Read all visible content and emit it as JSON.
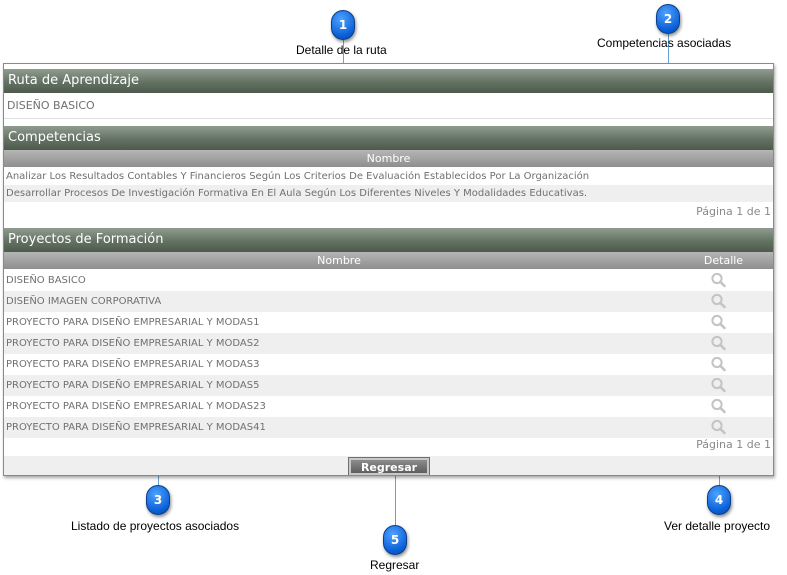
{
  "ruta": {
    "header": "Ruta de Aprendizaje",
    "value": "DISEÑO BASICO"
  },
  "competencias": {
    "header": "Competencias",
    "column": "Nombre",
    "rows": [
      "Analizar Los Resultados Contables Y Financieros Según Los Criterios De Evaluación Establecidos Por La Organización",
      "Desarrollar Procesos De Investigación Formativa En El Aula Según Los Diferentes Niveles Y Modalidades Educativas."
    ],
    "pager": "Página 1 de 1"
  },
  "proyectos": {
    "header": "Proyectos de Formación",
    "col_name": "Nombre",
    "col_detail": "Detalle",
    "rows": [
      "DISEÑO BASICO",
      "DISEÑO IMAGEN CORPORATIVA",
      "PROYECTO PARA DISEÑO EMPRESARIAL Y MODAS1",
      "PROYECTO PARA DISEÑO EMPRESARIAL Y MODAS2",
      "PROYECTO PARA DISEÑO EMPRESARIAL Y MODAS3",
      "PROYECTO PARA DISEÑO EMPRESARIAL Y MODAS5",
      "PROYECTO PARA DISEÑO EMPRESARIAL Y MODAS23",
      "PROYECTO PARA DISEÑO EMPRESARIAL Y MODAS41"
    ],
    "pager": "Página 1 de 1",
    "detail_icon": "magnifier-icon"
  },
  "button": {
    "regresar": "Regresar"
  },
  "callouts": [
    {
      "num": "1",
      "caption": "Detalle de la ruta"
    },
    {
      "num": "2",
      "caption": "Competencias asociadas"
    },
    {
      "num": "3",
      "caption": "Listado de proyectos asociados"
    },
    {
      "num": "4",
      "caption": "Ver detalle proyecto"
    },
    {
      "num": "5",
      "caption": "Regresar"
    }
  ],
  "colors": {
    "header_green": "#647264",
    "callout_blue": "#0a5fd6",
    "column_gray": "#8e8e8e"
  }
}
